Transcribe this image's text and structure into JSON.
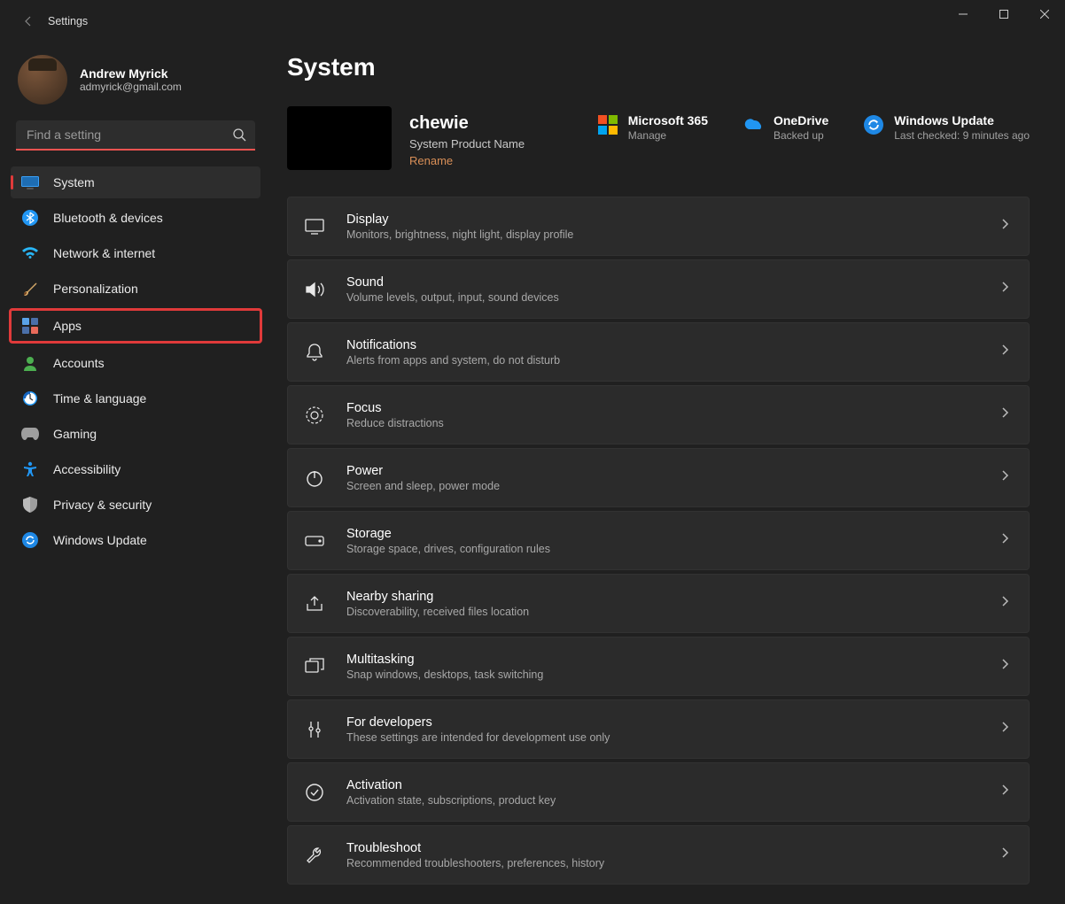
{
  "window": {
    "title": "Settings"
  },
  "user": {
    "name": "Andrew Myrick",
    "email": "admyrick@gmail.com"
  },
  "search": {
    "placeholder": "Find a setting"
  },
  "sidebar": {
    "items": [
      {
        "label": "System"
      },
      {
        "label": "Bluetooth & devices"
      },
      {
        "label": "Network & internet"
      },
      {
        "label": "Personalization"
      },
      {
        "label": "Apps"
      },
      {
        "label": "Accounts"
      },
      {
        "label": "Time & language"
      },
      {
        "label": "Gaming"
      },
      {
        "label": "Accessibility"
      },
      {
        "label": "Privacy & security"
      },
      {
        "label": "Windows Update"
      }
    ]
  },
  "page": {
    "title": "System"
  },
  "device": {
    "name": "chewie",
    "product": "System Product Name",
    "rename": "Rename"
  },
  "status": {
    "m365": {
      "title": "Microsoft 365",
      "sub": "Manage"
    },
    "onedrive": {
      "title": "OneDrive",
      "sub": "Backed up"
    },
    "update": {
      "title": "Windows Update",
      "sub": "Last checked: 9 minutes ago"
    }
  },
  "cards": [
    {
      "title": "Display",
      "sub": "Monitors, brightness, night light, display profile"
    },
    {
      "title": "Sound",
      "sub": "Volume levels, output, input, sound devices"
    },
    {
      "title": "Notifications",
      "sub": "Alerts from apps and system, do not disturb"
    },
    {
      "title": "Focus",
      "sub": "Reduce distractions"
    },
    {
      "title": "Power",
      "sub": "Screen and sleep, power mode"
    },
    {
      "title": "Storage",
      "sub": "Storage space, drives, configuration rules"
    },
    {
      "title": "Nearby sharing",
      "sub": "Discoverability, received files location"
    },
    {
      "title": "Multitasking",
      "sub": "Snap windows, desktops, task switching"
    },
    {
      "title": "For developers",
      "sub": "These settings are intended for development use only"
    },
    {
      "title": "Activation",
      "sub": "Activation state, subscriptions, product key"
    },
    {
      "title": "Troubleshoot",
      "sub": "Recommended troubleshooters, preferences, history"
    }
  ]
}
